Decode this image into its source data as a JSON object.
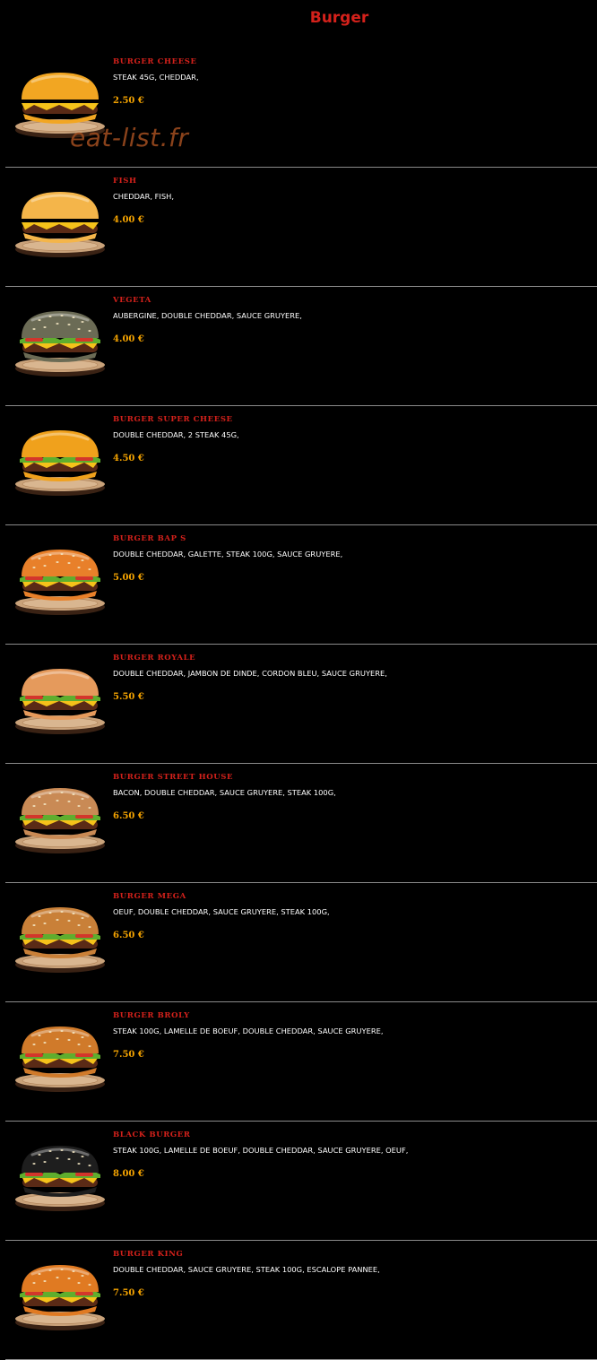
{
  "page": {
    "title": "Burger"
  },
  "watermark": "eat-list.fr",
  "colors": {
    "background": "#000000",
    "name": "#d4211b",
    "price": "#f4a300",
    "divider": "#8a8a8a"
  },
  "items": [
    {
      "name": "BURGER CHEESE",
      "description": "STEAK 45G, CHEDDAR,",
      "price": "2.50 €",
      "bun": "#f2a622",
      "seeds": false,
      "greens": false
    },
    {
      "name": "FISH",
      "description": "CHEDDAR, FISH,",
      "price": "4.00 €",
      "bun": "#f4b54a",
      "seeds": false,
      "greens": false
    },
    {
      "name": "VEGETA",
      "description": "AUBERGINE, DOUBLE CHEDDAR, SAUCE GRUYERE,",
      "price": "4.00 €",
      "bun": "#6b6b55",
      "seeds": true,
      "greens": true
    },
    {
      "name": "BURGER SUPER CHEESE",
      "description": "DOUBLE CHEDDAR, 2 STEAK 45G,",
      "price": "4.50 €",
      "bun": "#f0a11c",
      "seeds": false,
      "greens": true
    },
    {
      "name": "BURGER BAP S",
      "description": "DOUBLE CHEDDAR, GALETTE, STEAK 100G, SAUCE GRUYERE,",
      "price": "5.00 €",
      "bun": "#e8802a",
      "seeds": true,
      "greens": true
    },
    {
      "name": "BURGER ROYALE",
      "description": "DOUBLE CHEDDAR, JAMBON DE DINDE, CORDON BLEU, SAUCE GRUYERE,",
      "price": "5.50 €",
      "bun": "#e59a5c",
      "seeds": false,
      "greens": true
    },
    {
      "name": "BURGER STREET HOUSE",
      "description": "BACON, DOUBLE CHEDDAR, SAUCE GRUYERE, STEAK 100G,",
      "price": "6.50 €",
      "bun": "#c98a55",
      "seeds": true,
      "greens": true
    },
    {
      "name": "BURGER MEGA",
      "description": "OEUF, DOUBLE CHEDDAR, SAUCE GRUYERE, STEAK 100G,",
      "price": "6.50 €",
      "bun": "#c98038",
      "seeds": true,
      "greens": true
    },
    {
      "name": "BURGER BROLY",
      "description": "STEAK 100G, LAMELLE DE BOEUF, DOUBLE CHEDDAR, SAUCE GRUYERE,",
      "price": "7.50 €",
      "bun": "#d07a2a",
      "seeds": true,
      "greens": true
    },
    {
      "name": "BLACK BURGER",
      "description": "STEAK 100G, LAMELLE DE BOEUF, DOUBLE CHEDDAR, SAUCE GRUYERE, OEUF,",
      "price": "8.00 €",
      "bun": "#1e1e1e",
      "seeds": true,
      "greens": true
    },
    {
      "name": "BURGER KING",
      "description": "DOUBLE CHEDDAR, SAUCE GRUYERE, STEAK 100G, ESCALOPE PANNEE,",
      "price": "7.50 €",
      "bun": "#e07a22",
      "seeds": true,
      "greens": true
    }
  ]
}
